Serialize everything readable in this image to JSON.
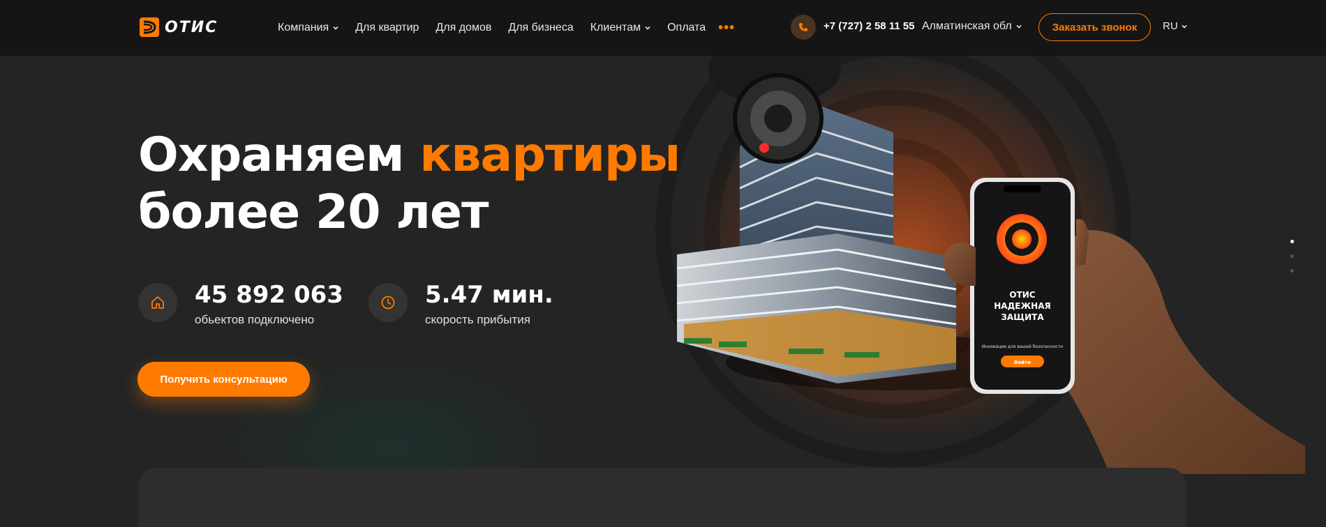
{
  "header": {
    "logo_text": "ОТИС",
    "nav": [
      {
        "label": "Компания",
        "has_dropdown": true
      },
      {
        "label": "Для квартир",
        "has_dropdown": false
      },
      {
        "label": "Для домов",
        "has_dropdown": false
      },
      {
        "label": "Для бизнеса",
        "has_dropdown": false
      },
      {
        "label": "Клиентам",
        "has_dropdown": true
      },
      {
        "label": "Оплата",
        "has_dropdown": false
      }
    ],
    "more_label": "•••",
    "phone": "+7 (727) 2 58 11 55",
    "region": "Алматинская обл",
    "callback_button": "Заказать звонок",
    "language": "RU"
  },
  "hero": {
    "title_part1": "Охраняем ",
    "title_accent": "квартиры",
    "title_line2": "более 20 лет",
    "stats": [
      {
        "icon": "home-icon",
        "value": "45 892 063",
        "label": "обьектов подключено"
      },
      {
        "icon": "clock-icon",
        "value": "5.47 мин.",
        "label": "скорость прибытия"
      }
    ],
    "cta_button": "Получить консультацию"
  },
  "phone_screen": {
    "title_line1": "ОТИС",
    "title_line2": "НАДЕЖНАЯ",
    "title_line3": "ЗАЩИТА",
    "subtitle": "Инновации для вашей безопасности",
    "button": "Войти"
  },
  "slider": {
    "total": 3,
    "active_index": 0
  },
  "colors": {
    "accent": "#ff7a00",
    "background": "#242424",
    "header": "#151515"
  }
}
